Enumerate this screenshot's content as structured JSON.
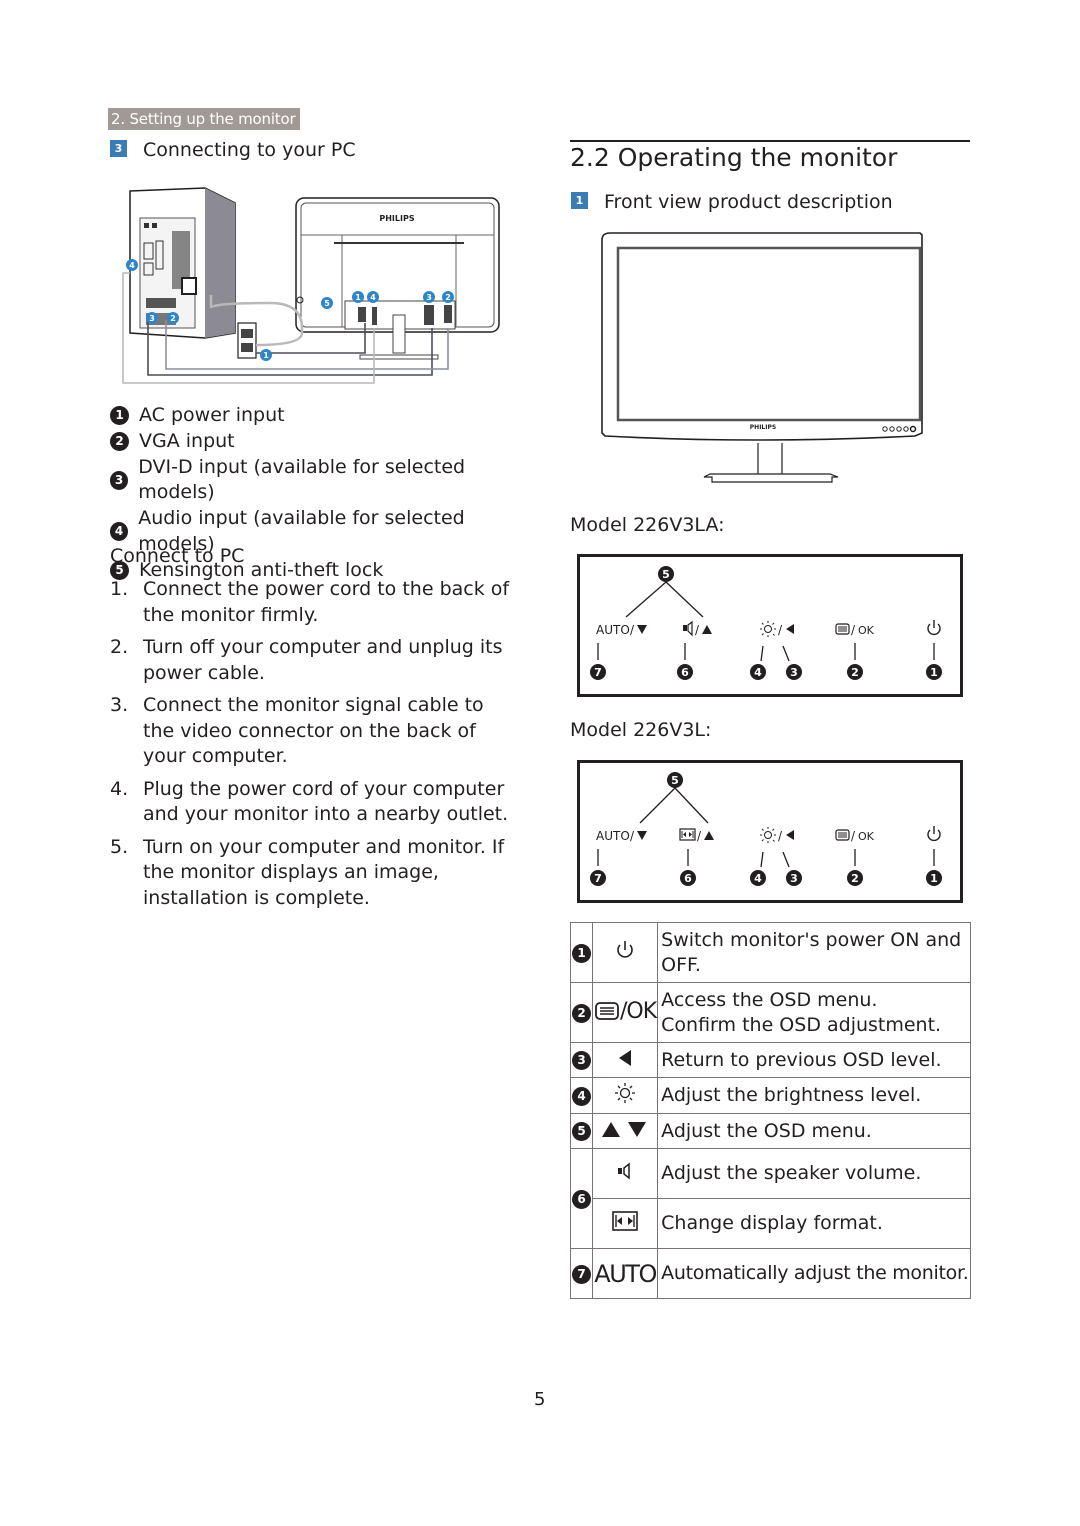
{
  "header": {
    "chapter_tag": "2. Setting up the monitor"
  },
  "left": {
    "section_badge": "3",
    "section_title": "Connecting to your PC",
    "diagram": {
      "brand_label": "PHILIPS",
      "callouts": [
        "1",
        "2",
        "3",
        "4",
        "5"
      ]
    },
    "legend": [
      {
        "num": "1",
        "label": "AC power input"
      },
      {
        "num": "2",
        "label": "VGA input"
      },
      {
        "num": "3",
        "label": "DVI-D input (available for selected models)"
      },
      {
        "num": "4",
        "label": "Audio input (available for selected models)"
      },
      {
        "num": "5",
        "label": "Kensington anti-theft lock"
      }
    ],
    "connect_title": "Connect to PC",
    "steps": [
      {
        "num": "1.",
        "text": "Connect the power cord to the back of the monitor firmly."
      },
      {
        "num": "2.",
        "text": "Turn off your computer and unplug its power cable."
      },
      {
        "num": "3.",
        "text": "Connect the monitor signal cable to the video connector on the back of your computer."
      },
      {
        "num": "4.",
        "text": "Plug the power cord of your computer and your monitor into a nearby outlet."
      },
      {
        "num": "5.",
        "text": "Turn on your computer and monitor. If the monitor displays an image,  installation is complete."
      }
    ]
  },
  "right": {
    "section_title": "2.2  Operating the monitor",
    "sub_badge": "1",
    "sub_title": "Front view product description",
    "front_view": {
      "brand_label": "PHILIPS"
    },
    "models": [
      {
        "label": "Model 226V3LA:",
        "keys": {
          "auto": "AUTO",
          "ok": "OK",
          "callout_top": "5",
          "callouts_bottom": [
            "7",
            "6",
            "4",
            "3",
            "2",
            "1"
          ]
        },
        "key6_icon": "speaker-icon"
      },
      {
        "label": "Model 226V3L:",
        "keys": {
          "auto": "AUTO",
          "ok": "OK",
          "callout_top": "5",
          "callouts_bottom": [
            "7",
            "6",
            "4",
            "3",
            "2",
            "1"
          ]
        },
        "key6_icon": "display-format-icon"
      }
    ],
    "table": [
      {
        "num": "1",
        "icon": "power-icon",
        "desc": "Switch monitor's power ON and OFF."
      },
      {
        "num": "2",
        "icon": "menu-ok-icon",
        "icon_text": "/OK",
        "desc_lines": [
          "Access the OSD menu.",
          "Confirm the OSD adjustment."
        ]
      },
      {
        "num": "3",
        "icon": "left-arrow-icon",
        "desc": "Return to previous OSD level."
      },
      {
        "num": "4",
        "icon": "brightness-icon",
        "desc": "Adjust the brightness level."
      },
      {
        "num": "5",
        "icon": "up-down-arrows-icon",
        "desc": "Adjust the OSD menu."
      },
      {
        "num": "6",
        "rows": [
          {
            "icon": "speaker-icon",
            "desc": "Adjust the speaker volume."
          },
          {
            "icon": "display-format-icon",
            "desc": "Change display format."
          }
        ]
      },
      {
        "num": "7",
        "icon": "auto-icon",
        "icon_text": "AUTO",
        "desc": "Automatically adjust the monitor."
      }
    ]
  },
  "footer": {
    "page_number": "5"
  }
}
